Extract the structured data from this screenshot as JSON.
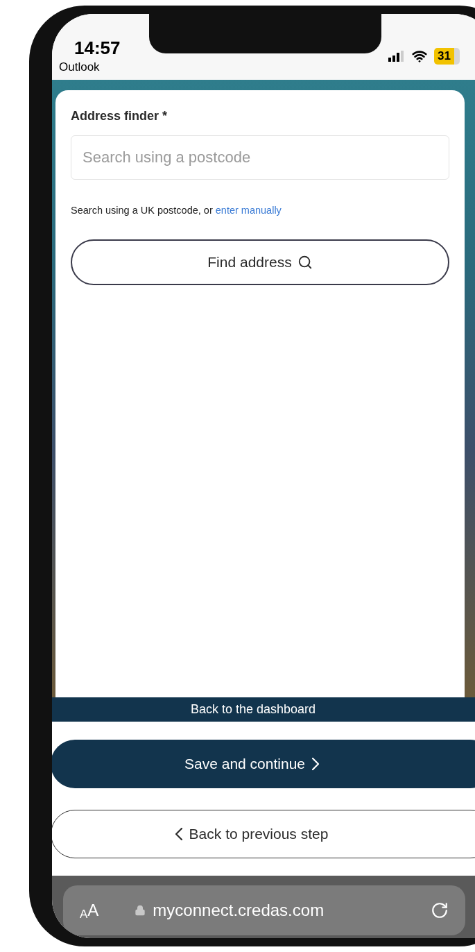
{
  "status_bar": {
    "time": "14:57",
    "back_app": "Outlook",
    "battery": "31"
  },
  "form": {
    "label": "Address finder *",
    "field": {
      "placeholder": "Search using a postcode"
    },
    "hint": "Search using a UK postcode, or",
    "hint_link": "enter manually",
    "find_button": "Find address"
  },
  "dashboard_link": "Back to the dashboard",
  "buttons": [
    {
      "kind": "primary",
      "label": "Save and continue"
    },
    {
      "kind": "secondary",
      "label": "Back to previous step"
    }
  ],
  "browser_bar": {
    "text_size": "AA",
    "url": "myconnect.credas.com"
  }
}
